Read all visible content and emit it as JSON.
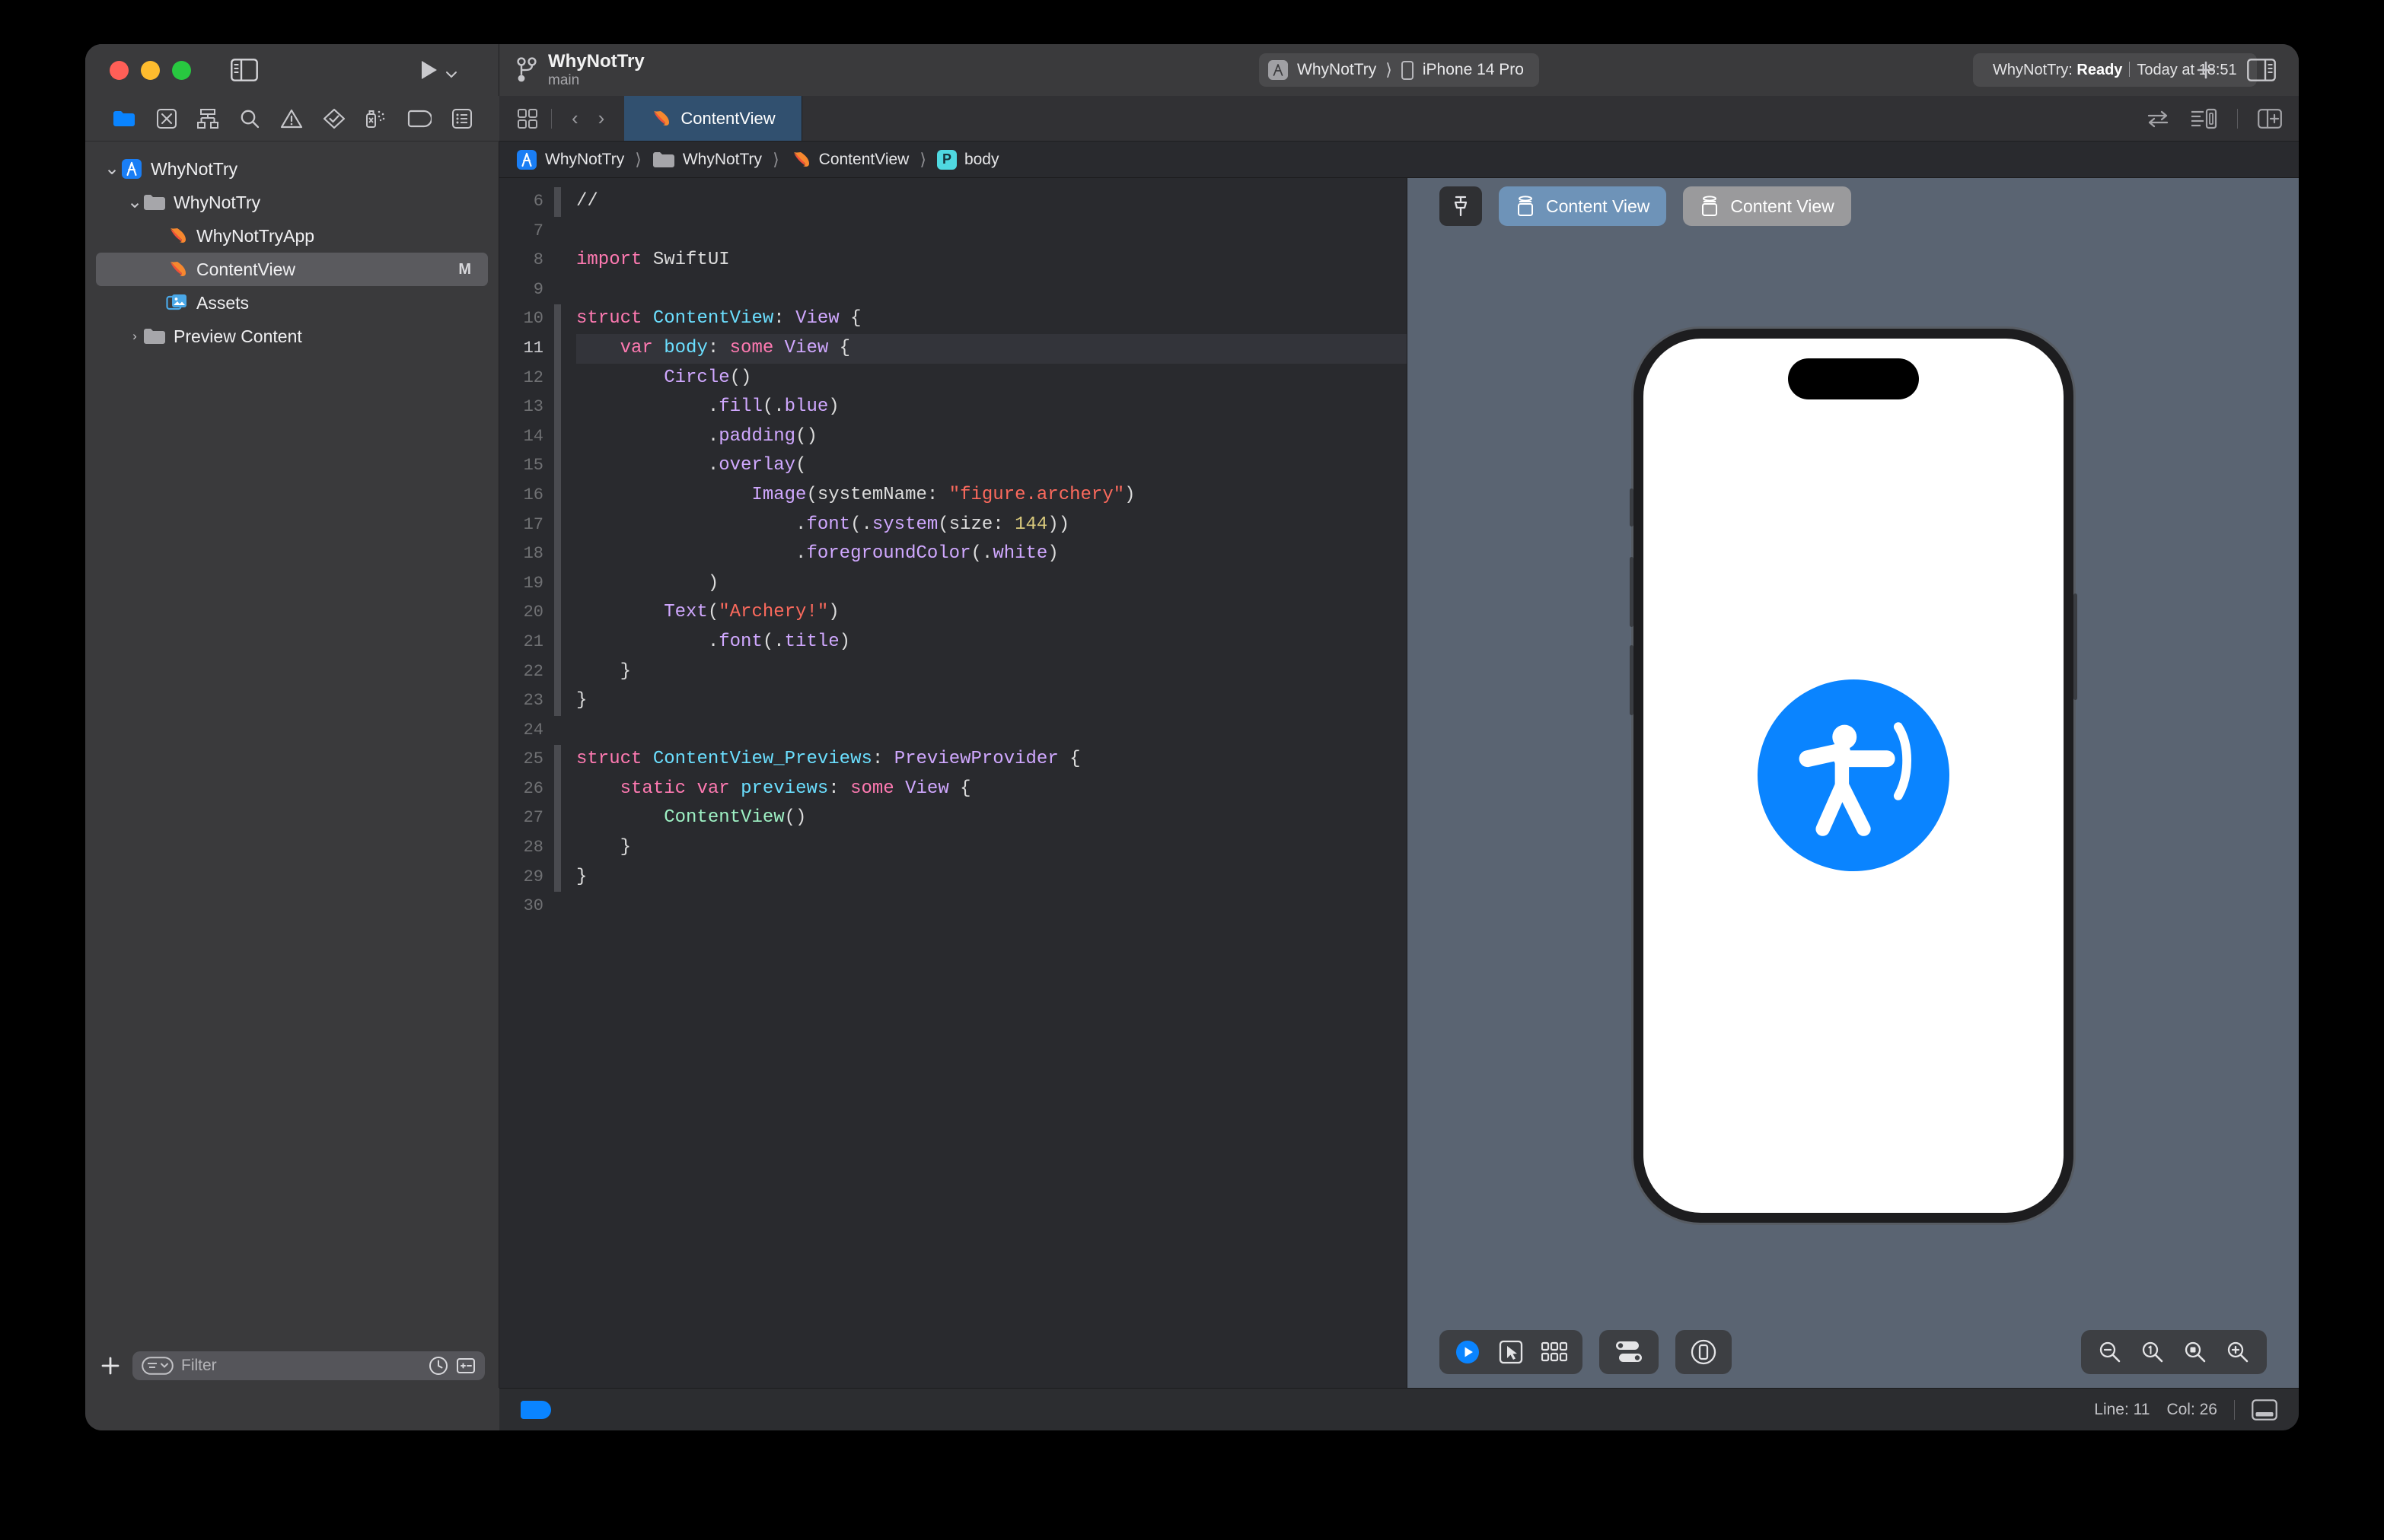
{
  "window": {
    "traffic_lights": [
      "close",
      "minimize",
      "zoom"
    ]
  },
  "toolbar": {
    "project_name": "WhyNotTry",
    "branch": "main",
    "scheme_target": "WhyNotTry",
    "scheme_device": "iPhone 14 Pro",
    "status_prefix": "WhyNotTry: ",
    "status_state": "Ready",
    "status_time": "Today at 18:51",
    "run_label": "run-button",
    "add_label": "+",
    "icons": {
      "sidebar_toggle": "sidebar-toggle-icon",
      "run": "play-icon",
      "run_chevron": "chevron-down-icon",
      "add": "plus-icon",
      "inspector_toggle": "inspector-toggle-icon"
    }
  },
  "navigator": {
    "tabs": [
      {
        "name": "project-navigator",
        "icon": "folder-icon",
        "active": true
      },
      {
        "name": "source-control-navigator",
        "icon": "source-control-icon",
        "active": false
      },
      {
        "name": "symbol-navigator",
        "icon": "hierarchy-icon",
        "active": false
      },
      {
        "name": "find-navigator",
        "icon": "search-icon",
        "active": false
      },
      {
        "name": "issue-navigator",
        "icon": "warning-triangle-icon",
        "active": false
      },
      {
        "name": "test-navigator",
        "icon": "diamond-check-icon",
        "active": false
      },
      {
        "name": "debug-navigator",
        "icon": "spray-icon",
        "active": false
      },
      {
        "name": "breakpoint-navigator",
        "icon": "tag-icon",
        "active": false
      },
      {
        "name": "report-navigator",
        "icon": "report-list-icon",
        "active": false
      }
    ],
    "tree": [
      {
        "label": "WhyNotTry",
        "icon": "xcode-project-icon",
        "indent": 0,
        "disclosure": "open",
        "selected": false,
        "modified": ""
      },
      {
        "label": "WhyNotTry",
        "icon": "folder-icon",
        "indent": 1,
        "disclosure": "open",
        "selected": false,
        "modified": ""
      },
      {
        "label": "WhyNotTryApp",
        "icon": "swift-file-icon",
        "indent": 2,
        "disclosure": "none",
        "selected": false,
        "modified": ""
      },
      {
        "label": "ContentView",
        "icon": "swift-file-icon",
        "indent": 2,
        "disclosure": "none",
        "selected": true,
        "modified": "M"
      },
      {
        "label": "Assets",
        "icon": "assets-icon",
        "indent": 2,
        "disclosure": "none",
        "selected": false,
        "modified": ""
      },
      {
        "label": "Preview Content",
        "icon": "folder-icon",
        "indent": 1,
        "disclosure": "closed",
        "selected": false,
        "modified": ""
      }
    ],
    "footer": {
      "add_label": "+",
      "filter_placeholder": "Filter",
      "filter_value": "",
      "icons": [
        "filter-dropdown-icon",
        "clock-icon",
        "recent-changes-icon"
      ]
    }
  },
  "editor": {
    "tab_label": "ContentView",
    "tab_icon": "swift-file-icon",
    "nav_back": "‹",
    "nav_forward": "›",
    "grid_icon": "tab-grid-icon",
    "right_icons": [
      "swap-arrows-icon",
      "canvas-layout-icon",
      "add-editor-icon"
    ],
    "breadcrumb": [
      {
        "label": "WhyNotTry",
        "icon": "xcode-project-icon"
      },
      {
        "label": "WhyNotTry",
        "icon": "folder-icon"
      },
      {
        "label": "ContentView",
        "icon": "swift-file-icon"
      },
      {
        "label": "body",
        "icon": "property-badge"
      }
    ],
    "first_line_number": 6,
    "current_line": 11,
    "lines": [
      {
        "n": 6,
        "ribbon": true,
        "tokens": [
          {
            "t": "//",
            "c": "pl"
          }
        ]
      },
      {
        "n": 7,
        "ribbon": false,
        "tokens": []
      },
      {
        "n": 8,
        "ribbon": false,
        "tokens": [
          {
            "t": "import",
            "c": "kw"
          },
          {
            "t": " SwiftUI",
            "c": "pl"
          }
        ]
      },
      {
        "n": 9,
        "ribbon": false,
        "tokens": []
      },
      {
        "n": 10,
        "ribbon": true,
        "tokens": [
          {
            "t": "struct",
            "c": "kw"
          },
          {
            "t": " ",
            "c": "pl"
          },
          {
            "t": "ContentView",
            "c": "ty"
          },
          {
            "t": ": ",
            "c": "pl"
          },
          {
            "t": "View",
            "c": "ty2"
          },
          {
            "t": " {",
            "c": "pl"
          }
        ]
      },
      {
        "n": 11,
        "ribbon": true,
        "tokens": [
          {
            "t": "    ",
            "c": "pl"
          },
          {
            "t": "var",
            "c": "kw"
          },
          {
            "t": " ",
            "c": "pl"
          },
          {
            "t": "body",
            "c": "ty"
          },
          {
            "t": ": ",
            "c": "pl"
          },
          {
            "t": "some",
            "c": "kw"
          },
          {
            "t": " ",
            "c": "pl"
          },
          {
            "t": "View",
            "c": "ty2"
          },
          {
            "t": " {",
            "c": "pl"
          }
        ]
      },
      {
        "n": 12,
        "ribbon": true,
        "tokens": [
          {
            "t": "        ",
            "c": "pl"
          },
          {
            "t": "Circle",
            "c": "ty2"
          },
          {
            "t": "()",
            "c": "pl"
          }
        ]
      },
      {
        "n": 13,
        "ribbon": true,
        "tokens": [
          {
            "t": "            .",
            "c": "pl"
          },
          {
            "t": "fill",
            "c": "fn"
          },
          {
            "t": "(.",
            "c": "pl"
          },
          {
            "t": "blue",
            "c": "fn"
          },
          {
            "t": ")",
            "c": "pl"
          }
        ]
      },
      {
        "n": 14,
        "ribbon": true,
        "tokens": [
          {
            "t": "            .",
            "c": "pl"
          },
          {
            "t": "padding",
            "c": "fn"
          },
          {
            "t": "()",
            "c": "pl"
          }
        ]
      },
      {
        "n": 15,
        "ribbon": true,
        "tokens": [
          {
            "t": "            .",
            "c": "pl"
          },
          {
            "t": "overlay",
            "c": "fn"
          },
          {
            "t": "(",
            "c": "pl"
          }
        ]
      },
      {
        "n": 16,
        "ribbon": true,
        "tokens": [
          {
            "t": "                ",
            "c": "pl"
          },
          {
            "t": "Image",
            "c": "ty2"
          },
          {
            "t": "(systemName: ",
            "c": "pl"
          },
          {
            "t": "\"figure.archery\"",
            "c": "st"
          },
          {
            "t": ")",
            "c": "pl"
          }
        ]
      },
      {
        "n": 17,
        "ribbon": true,
        "tokens": [
          {
            "t": "                    .",
            "c": "pl"
          },
          {
            "t": "font",
            "c": "fn"
          },
          {
            "t": "(.",
            "c": "pl"
          },
          {
            "t": "system",
            "c": "fn"
          },
          {
            "t": "(size: ",
            "c": "pl"
          },
          {
            "t": "144",
            "c": "nm"
          },
          {
            "t": "))",
            "c": "pl"
          }
        ]
      },
      {
        "n": 18,
        "ribbon": true,
        "tokens": [
          {
            "t": "                    .",
            "c": "pl"
          },
          {
            "t": "foregroundColor",
            "c": "fn"
          },
          {
            "t": "(.",
            "c": "pl"
          },
          {
            "t": "white",
            "c": "fn"
          },
          {
            "t": ")",
            "c": "pl"
          }
        ]
      },
      {
        "n": 19,
        "ribbon": true,
        "tokens": [
          {
            "t": "            )",
            "c": "pl"
          }
        ]
      },
      {
        "n": 20,
        "ribbon": true,
        "tokens": [
          {
            "t": "        ",
            "c": "pl"
          },
          {
            "t": "Text",
            "c": "ty2"
          },
          {
            "t": "(",
            "c": "pl"
          },
          {
            "t": "\"Archery!\"",
            "c": "st"
          },
          {
            "t": ")",
            "c": "pl"
          }
        ]
      },
      {
        "n": 21,
        "ribbon": true,
        "tokens": [
          {
            "t": "            .",
            "c": "pl"
          },
          {
            "t": "font",
            "c": "fn"
          },
          {
            "t": "(.",
            "c": "pl"
          },
          {
            "t": "title",
            "c": "fn"
          },
          {
            "t": ")",
            "c": "pl"
          }
        ]
      },
      {
        "n": 22,
        "ribbon": true,
        "tokens": [
          {
            "t": "    }",
            "c": "pl"
          }
        ]
      },
      {
        "n": 23,
        "ribbon": true,
        "tokens": [
          {
            "t": "}",
            "c": "pl"
          }
        ]
      },
      {
        "n": 24,
        "ribbon": false,
        "tokens": []
      },
      {
        "n": 25,
        "ribbon": true,
        "tokens": [
          {
            "t": "struct",
            "c": "kw"
          },
          {
            "t": " ",
            "c": "pl"
          },
          {
            "t": "ContentView_Previews",
            "c": "ty"
          },
          {
            "t": ": ",
            "c": "pl"
          },
          {
            "t": "PreviewProvider",
            "c": "ty2"
          },
          {
            "t": " {",
            "c": "pl"
          }
        ]
      },
      {
        "n": 26,
        "ribbon": true,
        "tokens": [
          {
            "t": "    ",
            "c": "pl"
          },
          {
            "t": "static",
            "c": "kw"
          },
          {
            "t": " ",
            "c": "pl"
          },
          {
            "t": "var",
            "c": "kw"
          },
          {
            "t": " ",
            "c": "pl"
          },
          {
            "t": "previews",
            "c": "ty"
          },
          {
            "t": ": ",
            "c": "pl"
          },
          {
            "t": "some",
            "c": "kw"
          },
          {
            "t": " ",
            "c": "pl"
          },
          {
            "t": "View",
            "c": "ty2"
          },
          {
            "t": " {",
            "c": "pl"
          }
        ]
      },
      {
        "n": 27,
        "ribbon": true,
        "tokens": [
          {
            "t": "        ",
            "c": "pl"
          },
          {
            "t": "ContentView",
            "c": "mint"
          },
          {
            "t": "()",
            "c": "pl"
          }
        ]
      },
      {
        "n": 28,
        "ribbon": true,
        "tokens": [
          {
            "t": "    }",
            "c": "pl"
          }
        ]
      },
      {
        "n": 29,
        "ribbon": true,
        "tokens": [
          {
            "t": "}",
            "c": "pl"
          }
        ]
      },
      {
        "n": 30,
        "ribbon": false,
        "tokens": []
      }
    ]
  },
  "canvas": {
    "pin_icon": "pin-icon",
    "variants": [
      {
        "label": "Content View",
        "icon": "preview-cube-icon",
        "active": true
      },
      {
        "label": "Content View",
        "icon": "preview-cube-icon",
        "active": false
      }
    ],
    "preview": {
      "device": "iPhone 14 Pro",
      "circle_color": "#0a84ff",
      "symbol": "figure.archery",
      "symbol_color": "#ffffff",
      "background": "#ffffff"
    },
    "bottom_controls": [
      {
        "name": "live-preview-play-button",
        "icon": "play-circle-icon"
      },
      {
        "name": "selectable-mode-button",
        "icon": "cursor-box-icon"
      },
      {
        "name": "variants-grid-button",
        "icon": "grid-dots-icon"
      },
      {
        "name": "device-settings-button",
        "icon": "switches-icon"
      },
      {
        "name": "device-bezel-button",
        "icon": "device-circle-icon"
      }
    ],
    "zoom_controls": [
      {
        "name": "zoom-out-button",
        "icon": "magnifier-minus-icon"
      },
      {
        "name": "zoom-actual-size-button",
        "icon": "magnifier-one-icon"
      },
      {
        "name": "zoom-to-fit-button",
        "icon": "magnifier-fit-icon"
      },
      {
        "name": "zoom-in-button",
        "icon": "magnifier-plus-icon"
      }
    ]
  },
  "status_bar": {
    "line_label": "Line: 11",
    "col_label": "Col: 26",
    "debug_toggle_icon": "debug-area-toggle-icon",
    "breakpoint_tag": "breakpoint-tag"
  }
}
